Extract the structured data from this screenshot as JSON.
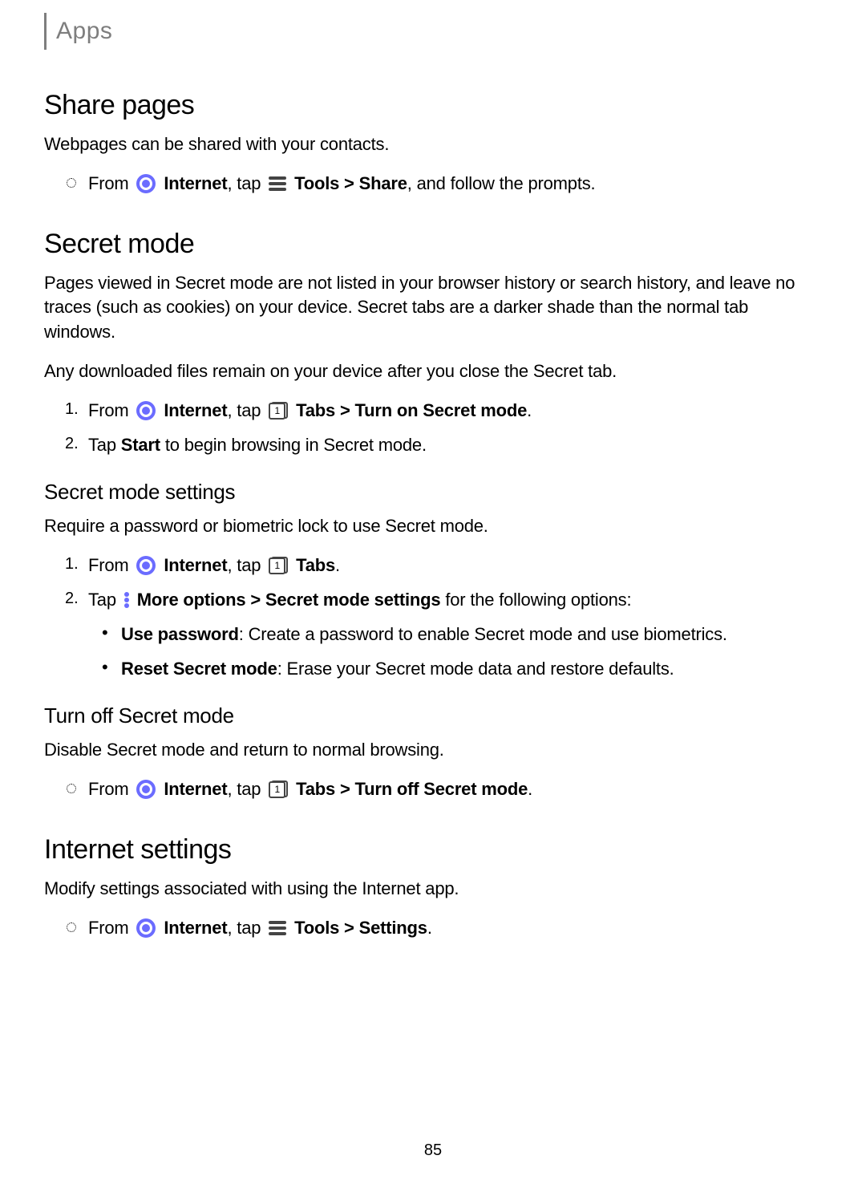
{
  "header": {
    "title": "Apps"
  },
  "page_number": "85",
  "share_pages": {
    "heading": "Share pages",
    "intro": "Webpages can be shared with your contacts.",
    "step": {
      "pre": "From ",
      "app": "Internet",
      "mid1": ", tap ",
      "tools": "Tools",
      "sep": " > ",
      "action": "Share",
      "tail": ", and follow the prompts."
    }
  },
  "secret_mode": {
    "heading": "Secret mode",
    "p1": "Pages viewed in Secret mode are not listed in your browser history or search history, and leave no traces (such as cookies) on your device. Secret tabs are a darker shade than the normal tab windows.",
    "p2": "Any downloaded files remain on your device after you close the Secret tab.",
    "step1": {
      "num": "1.",
      "pre": "From ",
      "app": "Internet",
      "mid": ", tap ",
      "tabs": "Tabs",
      "sep": " > ",
      "action": "Turn on Secret mode",
      "tail": "."
    },
    "step2": {
      "num": "2.",
      "pre": "Tap ",
      "action": "Start",
      "tail": " to begin browsing in Secret mode."
    },
    "settings": {
      "heading": "Secret mode settings",
      "intro": "Require a password or biometric lock to use Secret mode.",
      "step1": {
        "num": "1.",
        "pre": "From ",
        "app": "Internet",
        "mid": ", tap ",
        "tabs": "Tabs",
        "tail": "."
      },
      "step2": {
        "num": "2.",
        "pre": "Tap ",
        "more": "More options",
        "sep": " > ",
        "action": "Secret mode settings",
        "tail": " for the following options:"
      },
      "opt1": {
        "label": "Use password",
        "tail": ": Create a password to enable Secret mode and use biometrics."
      },
      "opt2": {
        "label": "Reset Secret mode",
        "tail": ": Erase your Secret mode data and restore defaults."
      }
    },
    "turnoff": {
      "heading": "Turn off Secret mode",
      "intro": "Disable Secret mode and return to normal browsing.",
      "step": {
        "pre": "From ",
        "app": "Internet",
        "mid": ", tap ",
        "tabs": "Tabs",
        "sep": " > ",
        "action": "Turn off Secret mode",
        "tail": "."
      }
    }
  },
  "internet_settings": {
    "heading": "Internet settings",
    "intro": "Modify settings associated with using the Internet app.",
    "step": {
      "pre": "From ",
      "app": "Internet",
      "mid": ", tap ",
      "tools": "Tools",
      "sep": " > ",
      "action": "Settings",
      "tail": "."
    }
  }
}
